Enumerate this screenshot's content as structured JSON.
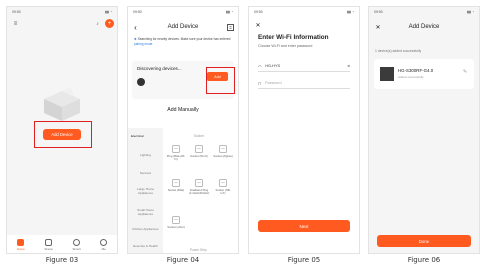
{
  "figures": [
    {
      "caption": "Figure 03"
    },
    {
      "caption": "Figure 04"
    },
    {
      "caption": "Figure 05"
    },
    {
      "caption": "Figure 06"
    }
  ],
  "status_time": "09:50",
  "phone1": {
    "add_device_label": "Add Device",
    "tabs": [
      {
        "label": "Home",
        "icon": "home-icon"
      },
      {
        "label": "Scene",
        "icon": "scene-icon"
      },
      {
        "label": "Smart",
        "icon": "smart-icon"
      },
      {
        "label": "Me",
        "icon": "me-icon"
      }
    ],
    "notification_count": "1"
  },
  "phone2": {
    "title": "Add Device",
    "note_text": "Searching for nearby devices. Make sure your device has entered ",
    "note_link": "pairing mode",
    "discovering_label": "Discovering devices...",
    "add_label": "Add",
    "add_manually": "Add Manually",
    "categories": [
      "Electrical",
      "Lighting",
      "Sensors",
      "Large Home Appliances",
      "Small Home Appliances",
      "Kitchen Appliances",
      "Exercise & Health"
    ],
    "column_head": "Socket",
    "tiles": [
      {
        "label": "Plug (BLE+Wi-Fi)"
      },
      {
        "label": "Socket (Wi-Fi)"
      },
      {
        "label": "Socket (Zigbee)"
      },
      {
        "label": "Socket (BLE)"
      },
      {
        "label": "Dualband Plug (2.4GHz&5GHz)"
      },
      {
        "label": "Socket (NB-IoT)"
      },
      {
        "label": "Socket (other)"
      }
    ],
    "power_strip_head": "Power Strip"
  },
  "phone3": {
    "title": "Enter Wi-Fi Information",
    "subtitle": "Choose Wi-Fi and enter password",
    "wifi_name": "HG-HYS",
    "password_placeholder": "Password",
    "next_label": "Next"
  },
  "phone4": {
    "title": "Add Device",
    "count_text": "1 device(s) added successfully",
    "device_name": "HG-S300RF-G4.0",
    "device_status": "Added successfully",
    "done_label": "Done"
  },
  "colors": {
    "accent": "#ff5a1f",
    "highlight": "#e02020"
  }
}
